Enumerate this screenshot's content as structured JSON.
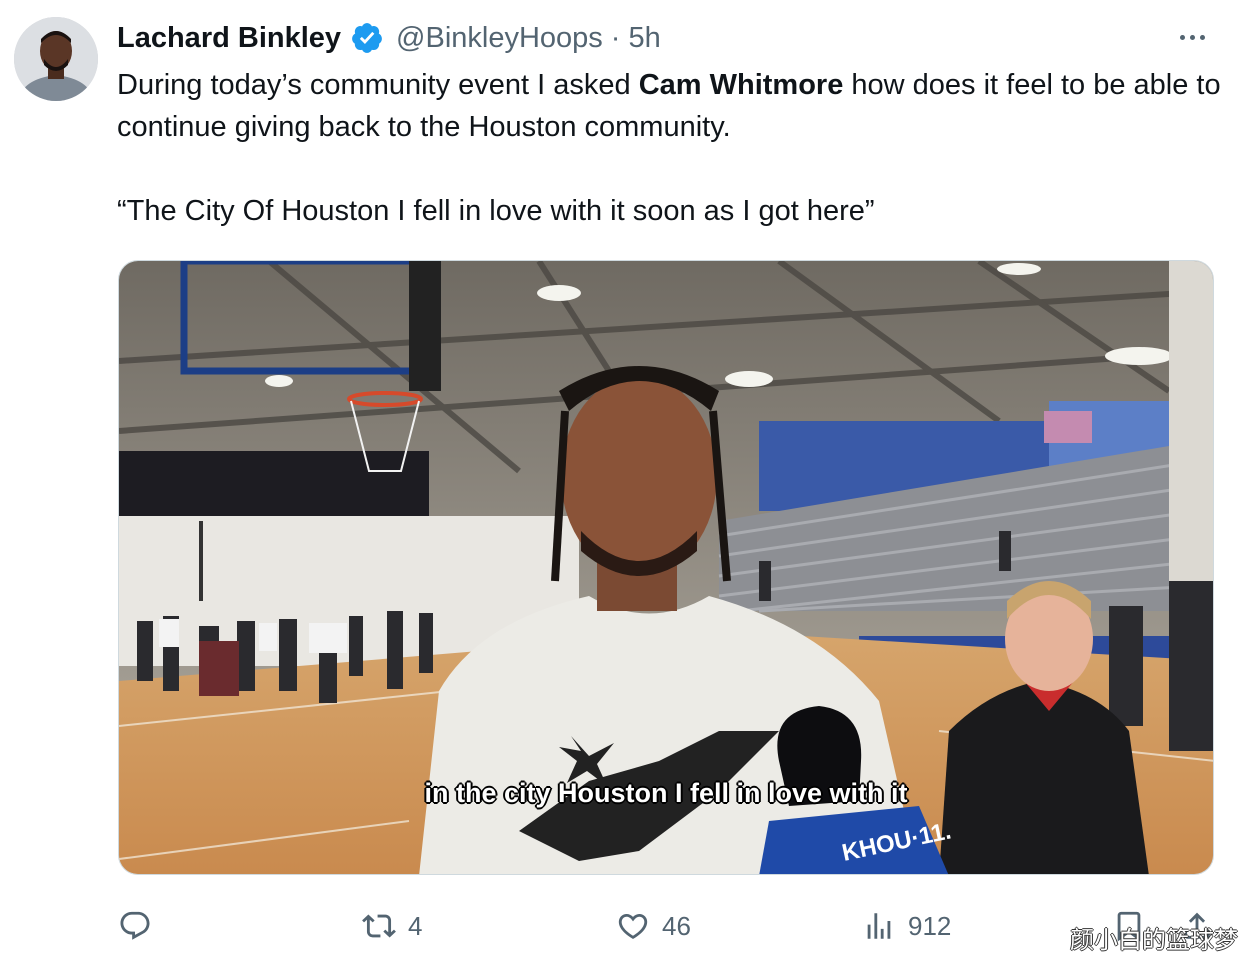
{
  "tweet": {
    "author_name": "Lachard Binkley",
    "handle": "@BinkleyHoops",
    "separator": "·",
    "time": "5h",
    "text_part1": "During today’s community event I asked ",
    "text_bold": "Cam Whitmore",
    "text_part2": " how does it feel to be able to continue giving back to the Houston community.",
    "quote": "“The City Of Houston I fell in love with it soon as I got here”"
  },
  "media": {
    "caption": "in the city Houston I fell in love with it",
    "mic_label": "KHOU·11."
  },
  "actions": {
    "reply_count": "",
    "retweet_count": "4",
    "like_count": "46",
    "views_count": "912"
  },
  "watermark": "颜小白的篮球梦",
  "colors": {
    "verified_blue": "#1d9bf0",
    "secondary_text": "#536471",
    "court": "#c9935a"
  },
  "icons": [
    "verified-badge-icon",
    "more-icon",
    "reply-icon",
    "retweet-icon",
    "like-icon",
    "views-icon",
    "bookmark-icon",
    "share-icon"
  ]
}
